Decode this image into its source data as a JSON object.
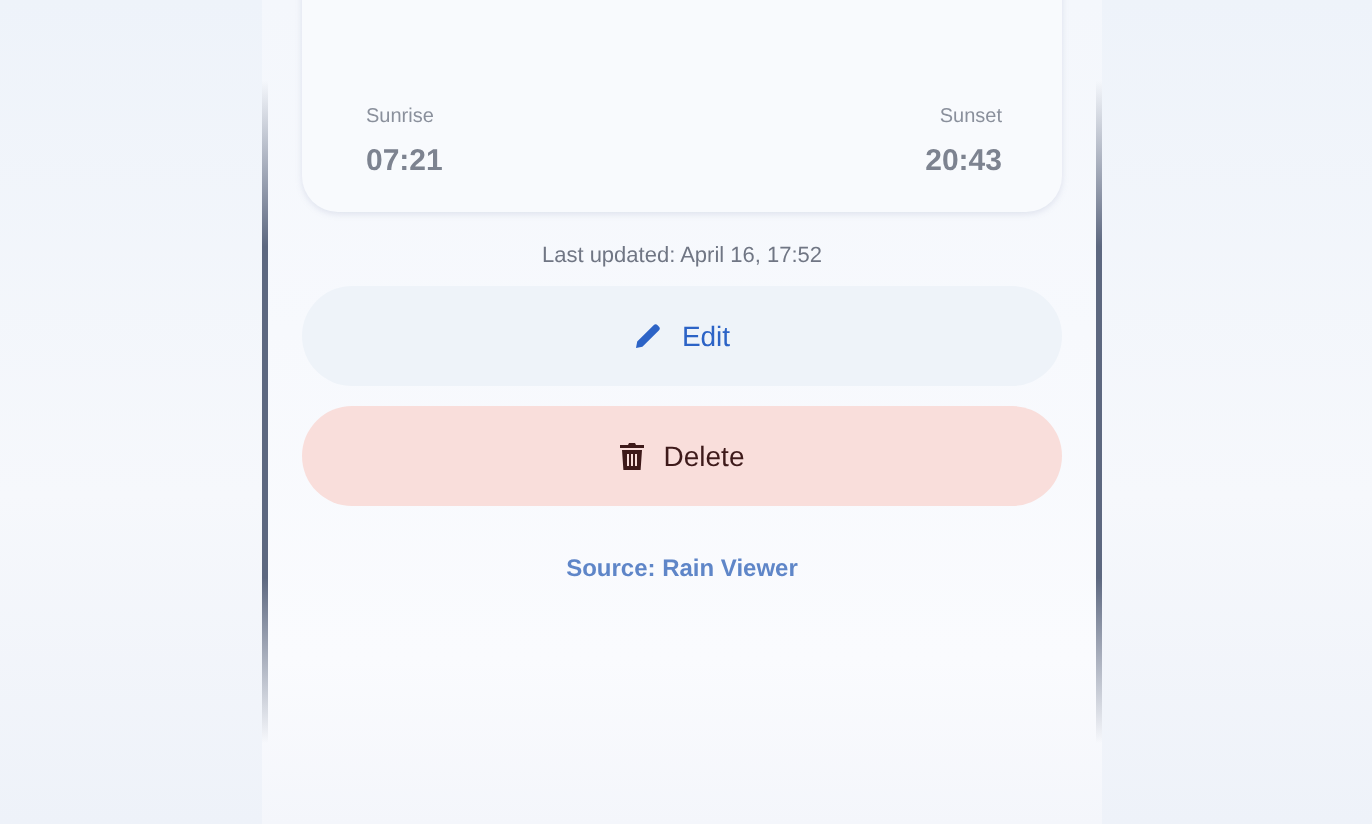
{
  "sun_times": [
    {
      "label": "Sunrise",
      "time": "07:21"
    },
    {
      "label": "Sunset",
      "time": "20:43"
    }
  ],
  "last_updated": "Last updated: April 16, 17:52",
  "buttons": [
    {
      "kind": "edit",
      "label": "Edit"
    },
    {
      "kind": "delete",
      "label": "Delete"
    }
  ],
  "source_link": "Source: Rain Viewer"
}
